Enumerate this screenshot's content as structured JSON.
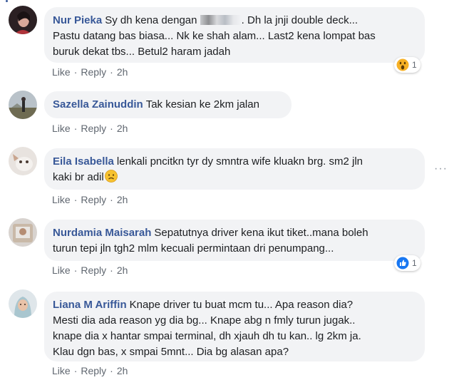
{
  "comments": [
    {
      "author": "Nur Pieka",
      "line1_prefix": "Sy dh kena dengan",
      "line1_suffix": ". Dh la jnji double deck...",
      "line2": "Pastu datang bas biasa... Nk ke shah alam... Last2 kena lompat bas",
      "line3": "buruk dekat tbs... Betul2 haram jadah",
      "like": "Like",
      "reply": "Reply",
      "time": "2h",
      "reaction_count": "1",
      "reaction_icon": "wow-emoji-icon"
    },
    {
      "author": "Sazella Zainuddin",
      "text": "Tak kesian ke 2km jalan",
      "like": "Like",
      "reply": "Reply",
      "time": "2h"
    },
    {
      "author": "Eila Isabella",
      "line1": "lenkali pncitkn tyr dy smntra wife kluakn brg. sm2 jln",
      "line2": "kaki br adil",
      "like": "Like",
      "reply": "Reply",
      "time": "2h",
      "emoji_icon": "worried-emoji-icon"
    },
    {
      "author": "Nurdamia Maisarah",
      "line1": "Sepatutnya driver kena ikut tiket..mana boleh",
      "line2": "turun tepi jln tgh2 mlm kecuali permintaan dri penumpang...",
      "like": "Like",
      "reply": "Reply",
      "time": "2h",
      "reaction_count": "1",
      "reaction_icon": "thumbs-up-icon"
    },
    {
      "author": "Liana M Ariffin",
      "line1": "Knape driver tu buat mcm tu... Apa reason dia?",
      "line2": "Mesti dia ada reason yg dia bg... Knape abg n fmly turun jugak..",
      "line3": "knape dia x hantar smpai terminal, dh xjauh dh tu kan.. lg 2km ja.",
      "line4": "Klau dgn bas, x smpai 5mnt... Dia bg alasan apa?",
      "like": "Like",
      "reply": "Reply",
      "time": "2h"
    }
  ],
  "colors": {
    "author": "#385898",
    "bubble": "#f2f3f5",
    "meta": "#606770",
    "like_blue": "#1877f2"
  }
}
